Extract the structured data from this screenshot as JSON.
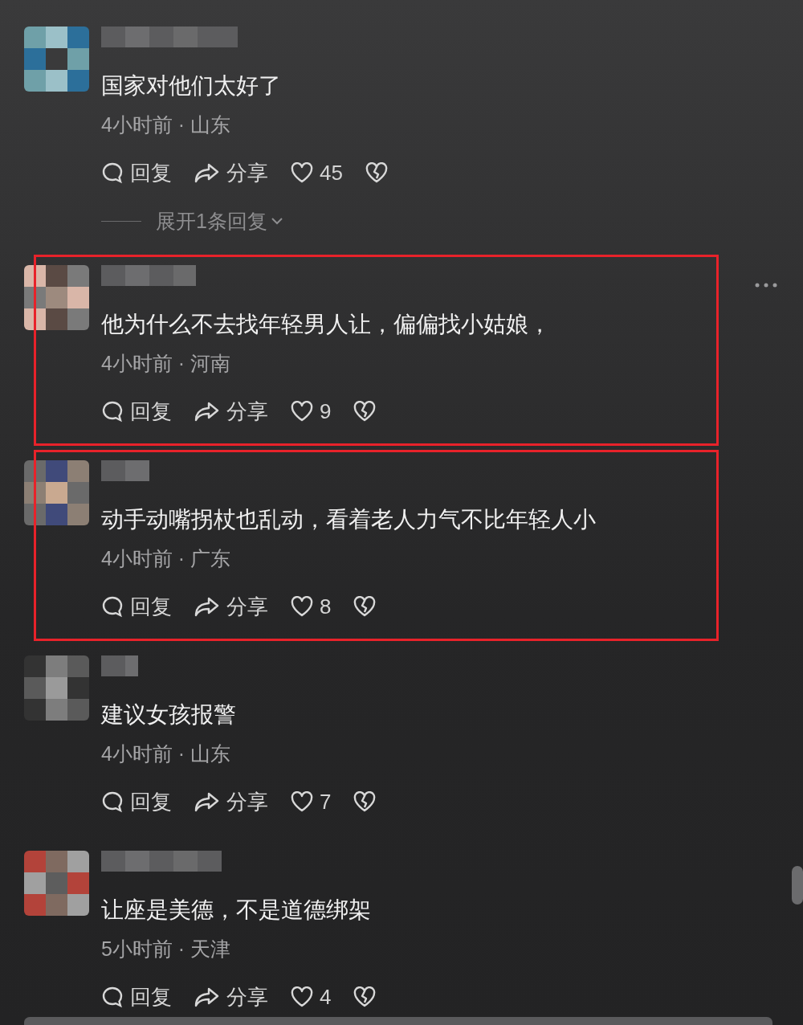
{
  "comments": [
    {
      "text": "国家对他们太好了",
      "meta": "4小时前 · 山东",
      "reply": "回复",
      "share": "分享",
      "likes": "45",
      "expand": "展开1条回复",
      "highlighted": false,
      "menu": false
    },
    {
      "text": "他为什么不去找年轻男人让，偏偏找小姑娘，",
      "meta": "4小时前 · 河南",
      "reply": "回复",
      "share": "分享",
      "likes": "9",
      "highlighted": true,
      "menu": true
    },
    {
      "text": "动手动嘴拐杖也乱动，看着老人力气不比年轻人小",
      "meta": "4小时前 · 广东",
      "reply": "回复",
      "share": "分享",
      "likes": "8",
      "highlighted": true,
      "menu": false
    },
    {
      "text": "建议女孩报警",
      "meta": "4小时前 · 山东",
      "reply": "回复",
      "share": "分享",
      "likes": "7",
      "highlighted": false,
      "menu": false
    },
    {
      "text": "让座是美德，不是道德绑架",
      "meta": "5小时前 · 天津",
      "reply": "回复",
      "share": "分享",
      "likes": "4",
      "highlighted": false,
      "menu": false
    }
  ]
}
